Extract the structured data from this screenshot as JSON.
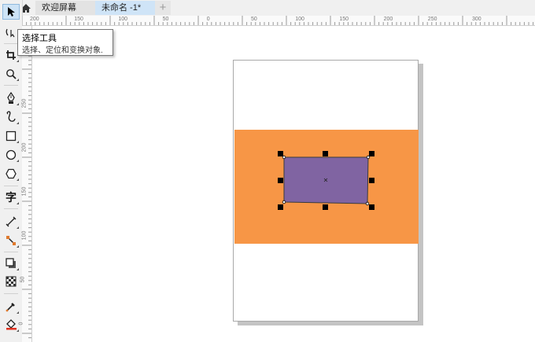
{
  "tabs": [
    {
      "label": "欢迎屏幕"
    },
    {
      "label": "未命名 -1*"
    }
  ],
  "tab_add": "+",
  "tooltip": {
    "title": "选择工具",
    "desc": "选择、定位和变换对象."
  },
  "text_tool_glyph": "字",
  "ruler": {
    "h_labels": [
      "200",
      "150",
      "100",
      "50",
      "0",
      "50",
      "100",
      "150",
      "200",
      "250",
      "300"
    ],
    "v_labels": [
      "250",
      "200",
      "150",
      "100",
      "50",
      "0"
    ]
  },
  "colors": {
    "accent": "#cde3f6",
    "rectangle_fill": "#f79646",
    "quad_fill": "#8064a2"
  }
}
